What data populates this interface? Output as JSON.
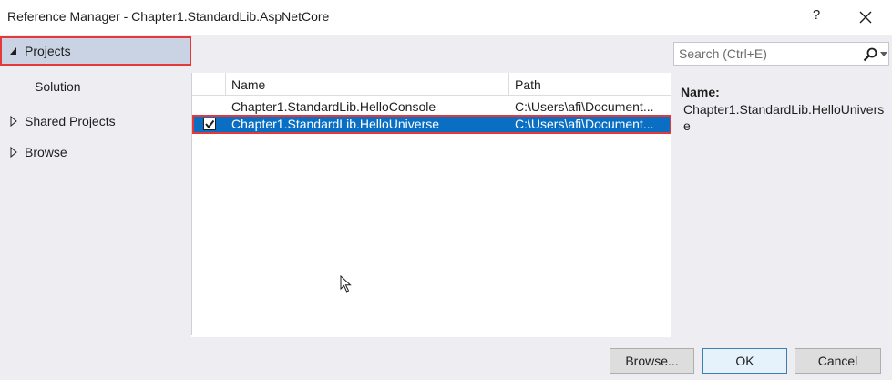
{
  "window": {
    "title": "Reference Manager - Chapter1.StandardLib.AspNetCore",
    "help_label": "?"
  },
  "sidebar": {
    "items": [
      {
        "label": "Projects",
        "expander": "expanded-triangle",
        "selected": true
      },
      {
        "label": "Solution"
      },
      {
        "label": "Shared Projects",
        "expander": "collapsed-triangle"
      },
      {
        "label": "Browse",
        "expander": "collapsed-triangle"
      }
    ]
  },
  "grid": {
    "columns": [
      "Name",
      "Path"
    ],
    "rows": [
      {
        "checked": false,
        "name": "Chapter1.StandardLib.HelloConsole",
        "path": "C:\\Users\\afi\\Document..."
      },
      {
        "checked": true,
        "name": "Chapter1.StandardLib.HelloUniverse",
        "path": "C:\\Users\\afi\\Document...",
        "selected": true
      }
    ]
  },
  "search": {
    "placeholder": "Search (Ctrl+E)",
    "icon": "search-icon"
  },
  "details": {
    "name_label": "Name:",
    "name_value": "Chapter1.StandardLib.HelloUniverse"
  },
  "footer": {
    "browse_label": "Browse...",
    "ok_label": "OK",
    "cancel_label": "Cancel"
  },
  "colors": {
    "selection": "#0a6fc2",
    "highlight_outline": "#e5383a",
    "pane_background": "#eeeef2"
  }
}
